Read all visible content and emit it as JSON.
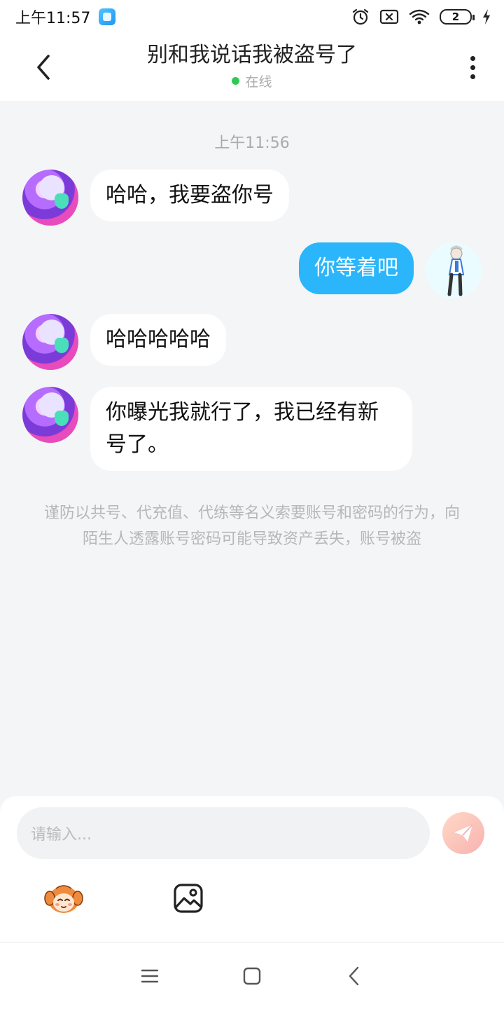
{
  "status_bar": {
    "time": "上午11:57",
    "battery_level": "2",
    "icons": [
      "app-icon",
      "alarm-icon",
      "no-sim-icon",
      "wifi-icon",
      "battery-icon",
      "charging-icon"
    ]
  },
  "header": {
    "title": "别和我说话我被盗号了",
    "status": "在线",
    "status_color": "#2fca55"
  },
  "chat": {
    "timestamp": "上午11:56",
    "messages": [
      {
        "sender": "other",
        "text": "哈哈，我要盗你号"
      },
      {
        "sender": "self",
        "text": "你等着吧"
      },
      {
        "sender": "other",
        "text": "哈哈哈哈哈"
      },
      {
        "sender": "other",
        "text": "你曝光我就行了，我已经有新号了。"
      }
    ],
    "notice": "谨防以共号、代充值、代练等名义索要账号和密码的行为，向陌生人透露账号密码可能导致资产丢失，账号被盗"
  },
  "input": {
    "placeholder": "请输入..."
  },
  "colors": {
    "self_bubble": "#2bb6fb",
    "other_bubble": "#ffffff",
    "background": "#f4f5f7"
  }
}
